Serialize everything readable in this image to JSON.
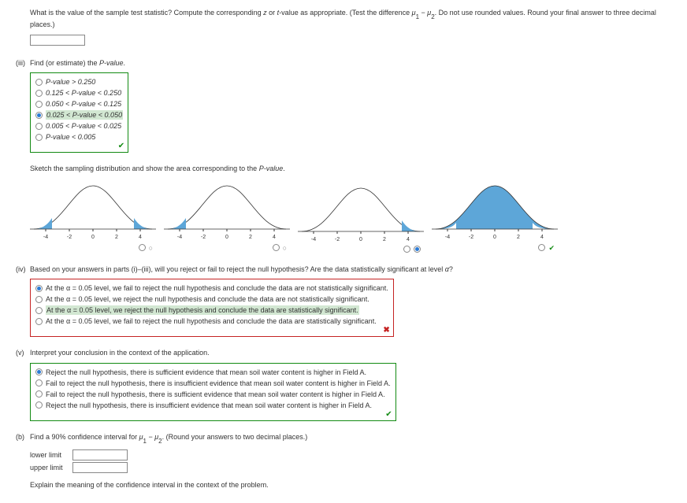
{
  "top_prompt_a": "What is the value of the sample test statistic? Compute the corresponding ",
  "top_prompt_b": " or ",
  "top_prompt_c": "-value as appropriate. (Test the difference ",
  "top_prompt_d": ". Do not use rounded values. Round your final answer to three decimal places.)",
  "z": "z",
  "t": "t",
  "mu1": "μ",
  "mu2": "μ",
  "s1": "1",
  "s2": "2",
  "minus": " − ",
  "iii": {
    "label": "(iii)",
    "prompt": "Find (or estimate) the ",
    "pv": "P-value",
    "end": ".",
    "opts": [
      "P-value > 0.250",
      "0.125 < P-value < 0.250",
      "0.050 < P-value < 0.125",
      "0.025 < P-value < 0.050",
      "0.005 < P-value < 0.025",
      "P-value < 0.005"
    ],
    "selected": 3,
    "correct": 3
  },
  "sketch_prompt": "Sketch the sampling distribution and show the area corresponding to the ",
  "ticks": [
    "-4",
    "-2",
    "0",
    "2",
    "4"
  ],
  "iv": {
    "label": "(iv)",
    "prompt_a": "Based on your answers in parts (i)–(iii), will you reject or fail to reject the null hypothesis? Are the data statistically significant at level ",
    "alpha": "α",
    "q": "?",
    "opts": [
      "At the α = 0.05 level, we fail to reject the null hypothesis and conclude the data are not statistically significant.",
      "At the α = 0.05 level, we reject the null hypothesis and conclude the data are not statistically significant.",
      "At the α = 0.05 level, we reject the null hypothesis and conclude the data are statistically significant.",
      "At the α = 0.05 level, we fail to reject the null hypothesis and conclude the data are statistically significant."
    ],
    "selected": 0,
    "correct": 2
  },
  "v": {
    "label": "(v)",
    "prompt": "Interpret your conclusion in the context of the application.",
    "opts": [
      "Reject the null hypothesis, there is sufficient evidence that mean soil water content is higher in Field A.",
      "Fail to reject the null hypothesis, there is insufficient evidence that mean soil water content is higher in Field A.",
      "Fail to reject the null hypothesis, there is sufficient evidence that mean soil water content is higher in Field A.",
      "Reject the null hypothesis, there is insufficient evidence that mean soil water content is higher in Field A."
    ],
    "selected": 0
  },
  "b": {
    "label": "(b)",
    "prompt_a": "Find a 90% confidence interval for ",
    "prompt_c": ". (Round your answers to two decimal places.)",
    "lower": "lower limit",
    "upper": "upper limit",
    "explain": "Explain the meaning of the confidence interval in the context of the problem."
  },
  "chart_selected": 2,
  "chart_correct": 3
}
